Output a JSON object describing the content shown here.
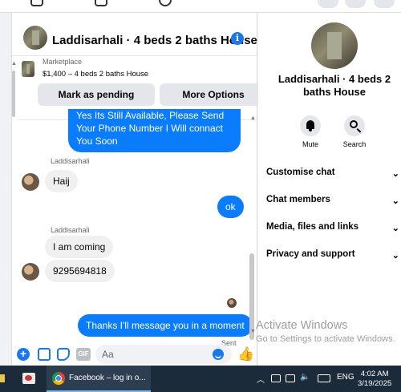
{
  "chat": {
    "title": "Laddisarhali · 4 beds 2 baths House",
    "marketplace": {
      "label": "Marketplace",
      "description": "$1,400 – 4 beds 2 baths House",
      "mark_pending": "Mark as pending",
      "more_options": "More Options"
    },
    "messages": [
      {
        "dir": "out",
        "text": "Yes Its Still Available, Please Send Your Phone Number I Will connact You Soon"
      },
      {
        "dir": "in",
        "sender": "Laddisarhali",
        "text": "Haij"
      },
      {
        "dir": "out",
        "text": "ok"
      },
      {
        "dir": "in",
        "sender": "Laddisarhali",
        "text": "I am coming"
      },
      {
        "dir": "in",
        "text": "9295694818"
      },
      {
        "dir": "out",
        "text": "Thanks I'll message you in a moment"
      }
    ],
    "sent_status": "Sent",
    "composer": {
      "placeholder": "Aa",
      "gif_label": "GIF",
      "plus_icon": "plus-icon",
      "like_icon": "thumbs-up-icon"
    },
    "accent_color": "#0a7cff"
  },
  "side": {
    "title": "Laddisarhali · 4 beds 2 baths House",
    "actions": [
      {
        "label": "Mute",
        "icon": "bell-icon"
      },
      {
        "label": "Search",
        "icon": "search-icon"
      }
    ],
    "sections": [
      "Customise chat",
      "Chat members",
      "Media, files and links",
      "Privacy and support"
    ]
  },
  "watermark": {
    "line1": "Activate Windows",
    "line2": "Go to Settings to activate Windows."
  },
  "taskbar": {
    "task_label": "Facebook – log in o...",
    "language": "ENG",
    "time": "4:02 AM",
    "date": "3/19/2025"
  }
}
